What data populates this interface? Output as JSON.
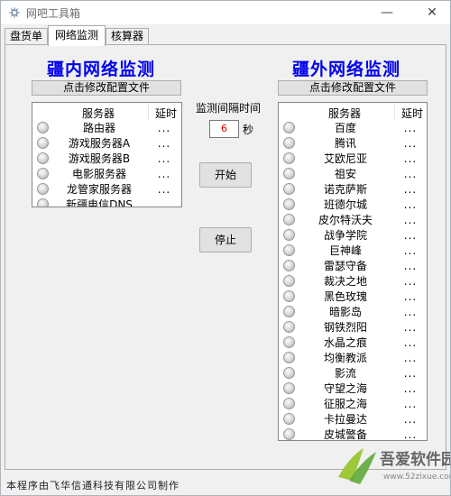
{
  "window": {
    "title": "网吧工具箱",
    "minimize": "—",
    "close": "✕"
  },
  "tabs": [
    {
      "label": "盘货单",
      "active": false
    },
    {
      "label": "网络监测",
      "active": true
    },
    {
      "label": "核算器",
      "active": false
    }
  ],
  "left_panel": {
    "heading": "疆内网络监测",
    "edit_config": "点击修改配置文件",
    "columns": {
      "server": "服务器",
      "latency": "延时"
    },
    "rows": [
      {
        "name": "路由器",
        "latency": "..."
      },
      {
        "name": "游戏服务器A",
        "latency": "..."
      },
      {
        "name": "游戏服务器B",
        "latency": "..."
      },
      {
        "name": "电影服务器",
        "latency": "..."
      },
      {
        "name": "龙管家服务器",
        "latency": "..."
      },
      {
        "name": "新疆电信DNS",
        "latency": "..."
      }
    ]
  },
  "right_panel": {
    "heading": "疆外网络监测",
    "edit_config": "点击修改配置文件",
    "columns": {
      "server": "服务器",
      "latency": "延时"
    },
    "rows": [
      {
        "name": "百度",
        "latency": "..."
      },
      {
        "name": "腾讯",
        "latency": "..."
      },
      {
        "name": "艾欧尼亚",
        "latency": "..."
      },
      {
        "name": "祖安",
        "latency": "..."
      },
      {
        "name": "诺克萨斯",
        "latency": "..."
      },
      {
        "name": "班德尔城",
        "latency": "..."
      },
      {
        "name": "皮尔特沃夫",
        "latency": "..."
      },
      {
        "name": "战争学院",
        "latency": "..."
      },
      {
        "name": "巨神峰",
        "latency": "..."
      },
      {
        "name": "雷瑟守备",
        "latency": "..."
      },
      {
        "name": "裁决之地",
        "latency": "..."
      },
      {
        "name": "黑色玫瑰",
        "latency": "..."
      },
      {
        "name": "暗影岛",
        "latency": "..."
      },
      {
        "name": "钢铁烈阳",
        "latency": "..."
      },
      {
        "name": "水晶之痕",
        "latency": "..."
      },
      {
        "name": "均衡教派",
        "latency": "..."
      },
      {
        "name": "影流",
        "latency": "..."
      },
      {
        "name": "守望之海",
        "latency": "..."
      },
      {
        "name": "征服之海",
        "latency": "..."
      },
      {
        "name": "卡拉曼达",
        "latency": "..."
      },
      {
        "name": "皮城警备",
        "latency": "..."
      }
    ]
  },
  "controls": {
    "interval_label": "监测间隔时间",
    "interval_value": "6",
    "interval_unit": "秒",
    "start": "开始",
    "stop": "停止"
  },
  "status": {
    "text": "本程序由飞华信通科技有限公司制作"
  },
  "watermark": {
    "text": "吾爱软件园",
    "url": "www.52zixue.com"
  },
  "colors": {
    "heading": "#0000ee",
    "interval_value": "#e00000"
  }
}
